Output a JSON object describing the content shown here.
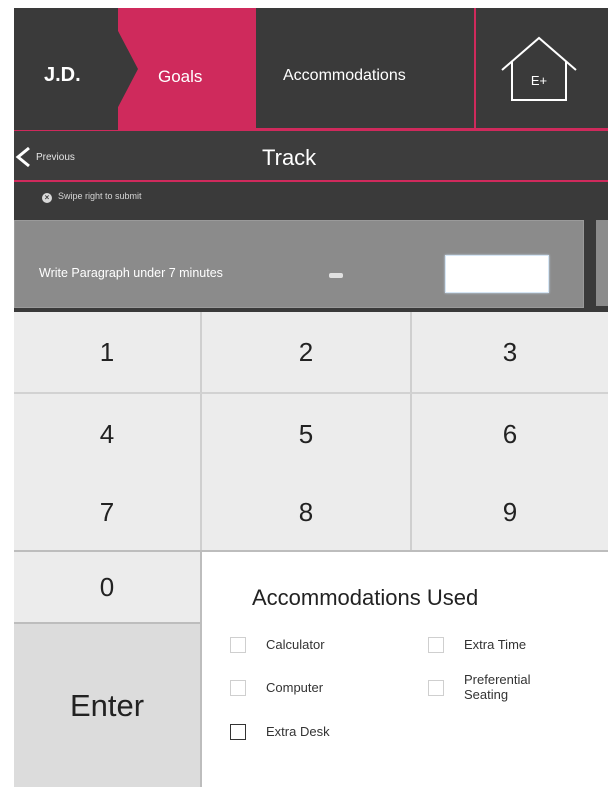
{
  "header": {
    "student_initials": "J.D.",
    "tabs": [
      {
        "label": "Goals",
        "active": true
      },
      {
        "label": "Accommodations",
        "active": false
      }
    ],
    "home_icon_text": "E+",
    "accent_color": "#cf2a5c"
  },
  "trackbar": {
    "previous_label": "Previous",
    "title": "Track"
  },
  "swipe_hint": {
    "icon": "close-circle-icon",
    "text": "Swipe right to submit"
  },
  "goal": {
    "text": "Write Paragraph under 7 minutes",
    "input_value": ""
  },
  "keypad": {
    "keys": [
      "1",
      "2",
      "3",
      "4",
      "5",
      "6",
      "7",
      "8",
      "9",
      "0"
    ],
    "enter_label": "Enter"
  },
  "accommodations_used": {
    "title": "Accommodations Used",
    "items": [
      {
        "label": "Calculator",
        "checked": false
      },
      {
        "label": "Extra Time",
        "checked": false
      },
      {
        "label": "Computer",
        "checked": false
      },
      {
        "label": "Preferential Seating",
        "checked": false
      },
      {
        "label": "Extra Desk",
        "checked": false
      }
    ]
  }
}
